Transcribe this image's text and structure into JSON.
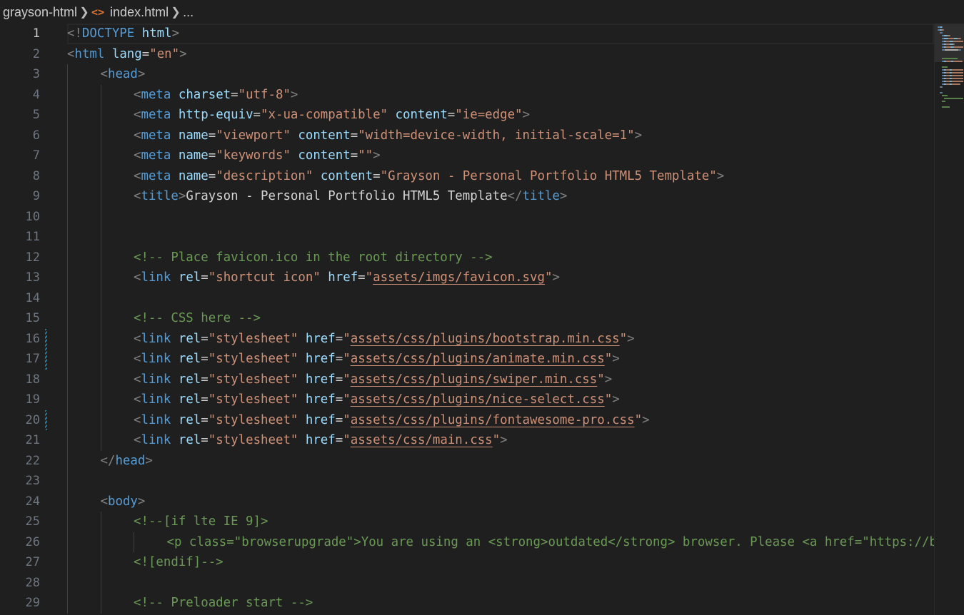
{
  "breadcrumb": {
    "folder": "grayson-html",
    "file_icon": "html-file-icon",
    "file": "index.html",
    "more": "..."
  },
  "editor": {
    "language": "html",
    "current_line": 1,
    "lines": [
      {
        "n": "1",
        "indent": 0,
        "tokens": [
          [
            "p",
            "<!"
          ],
          [
            "t",
            "DOCTYPE"
          ],
          [
            "a",
            " html"
          ],
          [
            "p",
            ">"
          ]
        ]
      },
      {
        "n": "2",
        "indent": 0,
        "tokens": [
          [
            "p",
            "<"
          ],
          [
            "t",
            "html"
          ],
          [
            "a",
            " lang"
          ],
          [
            "e",
            "="
          ],
          [
            "s",
            "\"en\""
          ],
          [
            "p",
            ">"
          ]
        ]
      },
      {
        "n": "3",
        "indent": 1,
        "tokens": [
          [
            "p",
            "<"
          ],
          [
            "t",
            "head"
          ],
          [
            "p",
            ">"
          ]
        ]
      },
      {
        "n": "4",
        "indent": 2,
        "tokens": [
          [
            "p",
            "<"
          ],
          [
            "t",
            "meta"
          ],
          [
            "a",
            " charset"
          ],
          [
            "e",
            "="
          ],
          [
            "s",
            "\"utf-8\""
          ],
          [
            "p",
            ">"
          ]
        ]
      },
      {
        "n": "5",
        "indent": 2,
        "tokens": [
          [
            "p",
            "<"
          ],
          [
            "t",
            "meta"
          ],
          [
            "a",
            " http-equiv"
          ],
          [
            "e",
            "="
          ],
          [
            "s",
            "\"x-ua-compatible\""
          ],
          [
            "a",
            " content"
          ],
          [
            "e",
            "="
          ],
          [
            "s",
            "\"ie=edge\""
          ],
          [
            "p",
            ">"
          ]
        ]
      },
      {
        "n": "6",
        "indent": 2,
        "tokens": [
          [
            "p",
            "<"
          ],
          [
            "t",
            "meta"
          ],
          [
            "a",
            " name"
          ],
          [
            "e",
            "="
          ],
          [
            "s",
            "\"viewport\""
          ],
          [
            "a",
            " content"
          ],
          [
            "e",
            "="
          ],
          [
            "s",
            "\"width=device-width, initial-scale=1\""
          ],
          [
            "p",
            ">"
          ]
        ]
      },
      {
        "n": "7",
        "indent": 2,
        "tokens": [
          [
            "p",
            "<"
          ],
          [
            "t",
            "meta"
          ],
          [
            "a",
            " name"
          ],
          [
            "e",
            "="
          ],
          [
            "s",
            "\"keywords\""
          ],
          [
            "a",
            " content"
          ],
          [
            "e",
            "="
          ],
          [
            "s",
            "\"\""
          ],
          [
            "p",
            ">"
          ]
        ]
      },
      {
        "n": "8",
        "indent": 2,
        "tokens": [
          [
            "p",
            "<"
          ],
          [
            "t",
            "meta"
          ],
          [
            "a",
            " name"
          ],
          [
            "e",
            "="
          ],
          [
            "s",
            "\"description\""
          ],
          [
            "a",
            " content"
          ],
          [
            "e",
            "="
          ],
          [
            "s",
            "\"Grayson - Personal Portfolio HTML5 Template\""
          ],
          [
            "p",
            ">"
          ]
        ]
      },
      {
        "n": "9",
        "indent": 2,
        "tokens": [
          [
            "p",
            "<"
          ],
          [
            "t",
            "title"
          ],
          [
            "p",
            ">"
          ],
          [
            "x",
            "Grayson - Personal Portfolio HTML5 Template"
          ],
          [
            "p",
            "</"
          ],
          [
            "t",
            "title"
          ],
          [
            "p",
            ">"
          ]
        ]
      },
      {
        "n": "10",
        "indent": 2,
        "tokens": []
      },
      {
        "n": "11",
        "indent": 2,
        "tokens": []
      },
      {
        "n": "12",
        "indent": 2,
        "tokens": [
          [
            "c",
            "<!-- Place favicon.ico in the root directory -->"
          ]
        ]
      },
      {
        "n": "13",
        "indent": 2,
        "tokens": [
          [
            "p",
            "<"
          ],
          [
            "t",
            "link"
          ],
          [
            "a",
            " rel"
          ],
          [
            "e",
            "="
          ],
          [
            "s",
            "\"shortcut icon\""
          ],
          [
            "a",
            " href"
          ],
          [
            "e",
            "="
          ],
          [
            "s",
            "\""
          ],
          [
            "u",
            "assets/imgs/favicon.svg"
          ],
          [
            "s",
            "\""
          ],
          [
            "p",
            ">"
          ]
        ]
      },
      {
        "n": "14",
        "indent": 2,
        "tokens": []
      },
      {
        "n": "15",
        "indent": 2,
        "tokens": [
          [
            "c",
            "<!-- CSS here -->"
          ]
        ]
      },
      {
        "n": "16",
        "indent": 2,
        "mod": true,
        "tokens": [
          [
            "p",
            "<"
          ],
          [
            "t",
            "link"
          ],
          [
            "a",
            " rel"
          ],
          [
            "e",
            "="
          ],
          [
            "s",
            "\"stylesheet\""
          ],
          [
            "a",
            " href"
          ],
          [
            "e",
            "="
          ],
          [
            "s",
            "\""
          ],
          [
            "u",
            "assets/css/plugins/bootstrap.min.css"
          ],
          [
            "s",
            "\""
          ],
          [
            "p",
            ">"
          ]
        ]
      },
      {
        "n": "17",
        "indent": 2,
        "mod": true,
        "tokens": [
          [
            "p",
            "<"
          ],
          [
            "t",
            "link"
          ],
          [
            "a",
            " rel"
          ],
          [
            "e",
            "="
          ],
          [
            "s",
            "\"stylesheet\""
          ],
          [
            "a",
            " href"
          ],
          [
            "e",
            "="
          ],
          [
            "s",
            "\""
          ],
          [
            "u",
            "assets/css/plugins/animate.min.css"
          ],
          [
            "s",
            "\""
          ],
          [
            "p",
            ">"
          ]
        ]
      },
      {
        "n": "18",
        "indent": 2,
        "tokens": [
          [
            "p",
            "<"
          ],
          [
            "t",
            "link"
          ],
          [
            "a",
            " rel"
          ],
          [
            "e",
            "="
          ],
          [
            "s",
            "\"stylesheet\""
          ],
          [
            "a",
            " href"
          ],
          [
            "e",
            "="
          ],
          [
            "s",
            "\""
          ],
          [
            "u",
            "assets/css/plugins/swiper.min.css"
          ],
          [
            "s",
            "\""
          ],
          [
            "p",
            ">"
          ]
        ]
      },
      {
        "n": "19",
        "indent": 2,
        "tokens": [
          [
            "p",
            "<"
          ],
          [
            "t",
            "link"
          ],
          [
            "a",
            " rel"
          ],
          [
            "e",
            "="
          ],
          [
            "s",
            "\"stylesheet\""
          ],
          [
            "a",
            " href"
          ],
          [
            "e",
            "="
          ],
          [
            "s",
            "\""
          ],
          [
            "u",
            "assets/css/plugins/nice-select.css"
          ],
          [
            "s",
            "\""
          ],
          [
            "p",
            ">"
          ]
        ]
      },
      {
        "n": "20",
        "indent": 2,
        "mod": true,
        "tokens": [
          [
            "p",
            "<"
          ],
          [
            "t",
            "link"
          ],
          [
            "a",
            " rel"
          ],
          [
            "e",
            "="
          ],
          [
            "s",
            "\"stylesheet\""
          ],
          [
            "a",
            " href"
          ],
          [
            "e",
            "="
          ],
          [
            "s",
            "\""
          ],
          [
            "u",
            "assets/css/plugins/fontawesome-pro.css"
          ],
          [
            "s",
            "\""
          ],
          [
            "p",
            ">"
          ]
        ]
      },
      {
        "n": "21",
        "indent": 2,
        "tokens": [
          [
            "p",
            "<"
          ],
          [
            "t",
            "link"
          ],
          [
            "a",
            " rel"
          ],
          [
            "e",
            "="
          ],
          [
            "s",
            "\"stylesheet\""
          ],
          [
            "a",
            " href"
          ],
          [
            "e",
            "="
          ],
          [
            "s",
            "\""
          ],
          [
            "u",
            "assets/css/main.css"
          ],
          [
            "s",
            "\""
          ],
          [
            "p",
            ">"
          ]
        ]
      },
      {
        "n": "22",
        "indent": 1,
        "tokens": [
          [
            "p",
            "</"
          ],
          [
            "t",
            "head"
          ],
          [
            "p",
            ">"
          ]
        ]
      },
      {
        "n": "23",
        "indent": 1,
        "tokens": []
      },
      {
        "n": "24",
        "indent": 1,
        "tokens": [
          [
            "p",
            "<"
          ],
          [
            "t",
            "body"
          ],
          [
            "p",
            ">"
          ]
        ]
      },
      {
        "n": "25",
        "indent": 2,
        "tokens": [
          [
            "c",
            "<!--[if lte IE 9]>"
          ]
        ]
      },
      {
        "n": "26",
        "indent": 3,
        "tokens": [
          [
            "c",
            "<p class=\"browserupgrade\">You are using an <strong>outdated</strong> browser. Please <a href=\"https://browsehappy.com/\">upgrade your browser</a> to improve your experience and security.</p>"
          ]
        ]
      },
      {
        "n": "27",
        "indent": 2,
        "tokens": [
          [
            "c",
            "<![endif]-->"
          ]
        ]
      },
      {
        "n": "28",
        "indent": 2,
        "tokens": []
      },
      {
        "n": "29",
        "indent": 2,
        "tokens": [
          [
            "c",
            "<!-- Preloader start -->"
          ]
        ]
      }
    ]
  }
}
